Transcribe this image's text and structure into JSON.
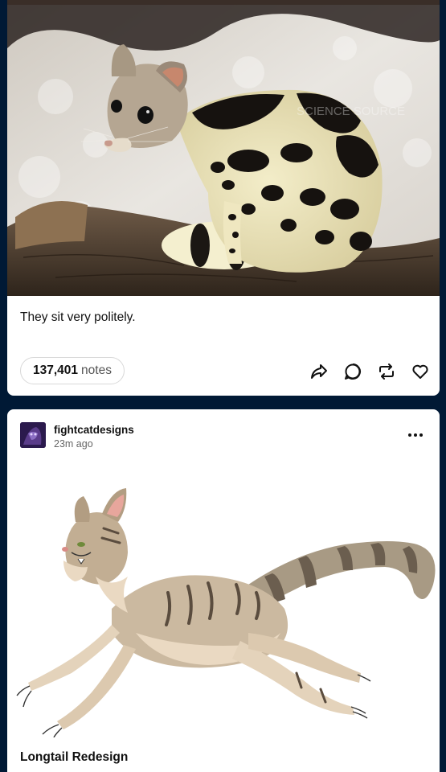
{
  "feed": {
    "posts": [
      {
        "caption": "They sit very politely.",
        "notes_count": "137,401",
        "notes_label": "notes",
        "photo_watermark": "SCIENCE SOURCE",
        "actions": [
          {
            "icon": "share-icon"
          },
          {
            "icon": "reply-icon"
          },
          {
            "icon": "reblog-icon"
          },
          {
            "icon": "like-icon"
          }
        ]
      },
      {
        "blog_name": "fightcatdesigns",
        "time_ago": "23m ago",
        "more_icon": "more-options-icon",
        "title": "Longtail Redesign"
      }
    ]
  },
  "colors": {
    "background": "#001935",
    "card": "#ffffff",
    "text": "#111111",
    "muted": "#555555"
  }
}
